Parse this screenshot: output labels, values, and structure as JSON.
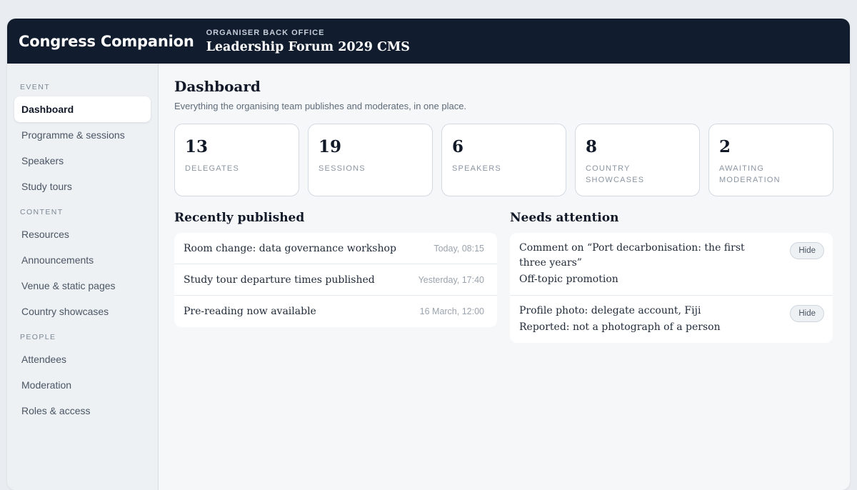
{
  "header": {
    "brand": "Congress Companion",
    "eyebrow": "Organiser back office",
    "title": "Leadership Forum 2029 CMS"
  },
  "sidebar": {
    "sections": [
      {
        "label": "Event",
        "items": [
          {
            "label": "Dashboard",
            "active": true
          },
          {
            "label": "Programme & sessions"
          },
          {
            "label": "Speakers"
          },
          {
            "label": "Study tours"
          }
        ]
      },
      {
        "label": "Content",
        "items": [
          {
            "label": "Resources"
          },
          {
            "label": "Announcements"
          },
          {
            "label": "Venue & static pages"
          },
          {
            "label": "Country showcases"
          }
        ]
      },
      {
        "label": "People",
        "items": [
          {
            "label": "Attendees"
          },
          {
            "label": "Moderation"
          },
          {
            "label": "Roles & access"
          }
        ]
      }
    ]
  },
  "main": {
    "title": "Dashboard",
    "subtitle": "Everything the organising team publishes and moderates, in one place.",
    "stats": [
      {
        "value": "13",
        "label": "Delegates"
      },
      {
        "value": "19",
        "label": "Sessions"
      },
      {
        "value": "6",
        "label": "Speakers"
      },
      {
        "value": "8",
        "label": "Country showcases"
      },
      {
        "value": "2",
        "label": "Awaiting moderation"
      }
    ],
    "recently_published": {
      "title": "Recently published",
      "items": [
        {
          "title": "Room change: data governance workshop",
          "time": "Today, 08:15"
        },
        {
          "title": "Study tour departure times published",
          "time": "Yesterday, 17:40"
        },
        {
          "title": "Pre-reading now available",
          "time": "16 March, 12:00"
        }
      ]
    },
    "needs_attention": {
      "title": "Needs attention",
      "items": [
        {
          "title": "Comment on “Port decarbonisation: the first three years”",
          "reason": "Off-topic promotion",
          "action": "Hide"
        },
        {
          "title": "Profile photo: delegate account, Fiji",
          "reason": "Reported: not a photograph of a person",
          "action": "Hide"
        }
      ]
    }
  }
}
